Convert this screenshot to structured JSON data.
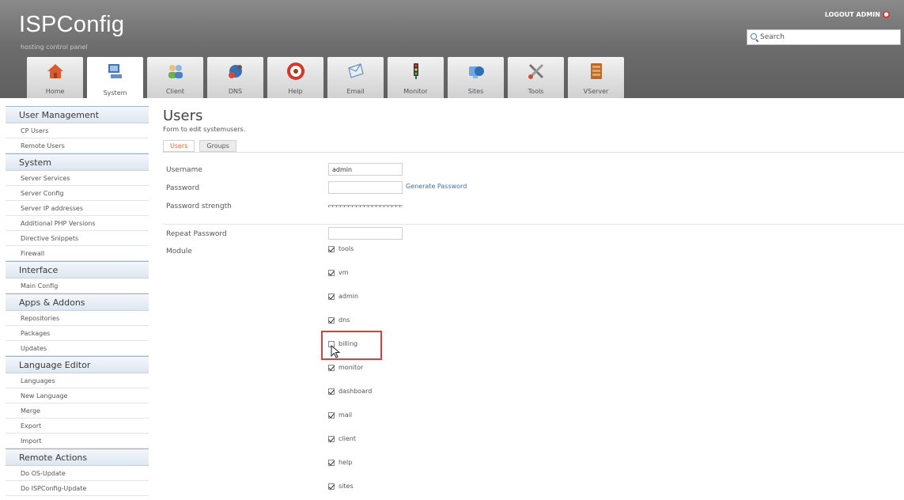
{
  "header": {
    "logo": "ISPConfig",
    "tagline": "hosting control panel",
    "logout": "LOGOUT ADMIN",
    "search_placeholder": "Search"
  },
  "tabs": [
    {
      "label": "Home",
      "icon": "home-icon"
    },
    {
      "label": "System",
      "icon": "system-icon",
      "active": true
    },
    {
      "label": "Client",
      "icon": "client-icon"
    },
    {
      "label": "DNS",
      "icon": "dns-icon"
    },
    {
      "label": "Help",
      "icon": "help-icon"
    },
    {
      "label": "Email",
      "icon": "email-icon"
    },
    {
      "label": "Monitor",
      "icon": "monitor-icon"
    },
    {
      "label": "Sites",
      "icon": "sites-icon"
    },
    {
      "label": "Tools",
      "icon": "tools-icon"
    },
    {
      "label": "VServer",
      "icon": "vserver-icon"
    }
  ],
  "sidebar": {
    "sections": [
      {
        "title": "User Management",
        "items": [
          "CP Users",
          "Remote Users"
        ]
      },
      {
        "title": "System",
        "items": [
          "Server Services",
          "Server Config",
          "Server IP addresses",
          "Additional PHP Versions",
          "Directive Snippets",
          "Firewall"
        ]
      },
      {
        "title": "Interface",
        "items": [
          "Main Config"
        ]
      },
      {
        "title": "Apps & Addons",
        "items": [
          "Repositories",
          "Packages",
          "Updates"
        ]
      },
      {
        "title": "Language Editor",
        "items": [
          "Languages",
          "New Language",
          "Merge",
          "Export",
          "Import"
        ]
      },
      {
        "title": "Remote Actions",
        "items": [
          "Do OS-Update",
          "Do ISPConfig-Update"
        ]
      }
    ]
  },
  "main": {
    "title": "Users",
    "subtitle": "Form to edit systemusers.",
    "subtabs": [
      {
        "label": "Users",
        "active": true
      },
      {
        "label": "Groups",
        "active": false
      }
    ],
    "form": {
      "username_label": "Username",
      "username_value": "admin",
      "password_label": "Password",
      "generate_password": "Generate Password",
      "strength_label": "Password strength",
      "repeat_label": "Repeat Password",
      "module_label": "Module"
    },
    "modules": [
      {
        "name": "tools",
        "checked": true
      },
      {
        "name": "vm",
        "checked": true
      },
      {
        "name": "admin",
        "checked": true
      },
      {
        "name": "dns",
        "checked": true
      },
      {
        "name": "billing",
        "checked": false
      },
      {
        "name": "monitor",
        "checked": true
      },
      {
        "name": "dashboard",
        "checked": true
      },
      {
        "name": "mail",
        "checked": true
      },
      {
        "name": "client",
        "checked": true
      },
      {
        "name": "help",
        "checked": true
      },
      {
        "name": "sites",
        "checked": true
      }
    ]
  },
  "colors": {
    "header_bg": "#6c6c6c",
    "active_subtab": "#d2682a",
    "link": "#3e6ea8",
    "highlight_box": "#d2403f"
  }
}
